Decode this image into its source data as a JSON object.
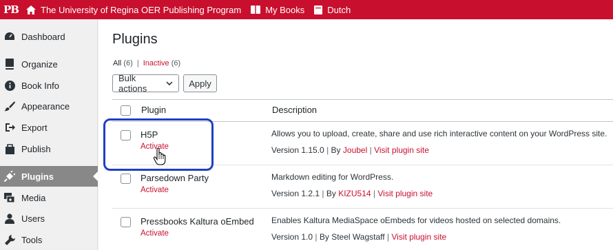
{
  "admin_bar": {
    "logo": "PB",
    "items": [
      {
        "label": "The University of Regina OER Publishing Program",
        "icon": "home-icon"
      },
      {
        "label": "My Books",
        "icon": "books-icon"
      },
      {
        "label": "Dutch",
        "icon": "book-icon"
      }
    ]
  },
  "sidebar": {
    "items": [
      {
        "label": "Dashboard",
        "icon": "dashboard-icon"
      },
      {
        "label": "Organize",
        "icon": "organize-icon"
      },
      {
        "label": "Book Info",
        "icon": "info-icon"
      },
      {
        "label": "Appearance",
        "icon": "brush-icon"
      },
      {
        "label": "Export",
        "icon": "export-icon"
      },
      {
        "label": "Publish",
        "icon": "publish-icon"
      },
      {
        "label": "Plugins",
        "icon": "plugin-icon"
      },
      {
        "label": "Media",
        "icon": "media-icon"
      },
      {
        "label": "Users",
        "icon": "users-icon"
      },
      {
        "label": "Tools",
        "icon": "tools-icon"
      }
    ],
    "active": "Plugins"
  },
  "main": {
    "title": "Plugins",
    "filters": {
      "all_label": "All",
      "all_count": "(6)",
      "separator": "|",
      "inactive_label": "Inactive",
      "inactive_count": "(6)"
    },
    "bulk_actions": {
      "selected": "Bulk actions"
    },
    "apply_label": "Apply",
    "table": {
      "columns": [
        "Plugin",
        "Description"
      ],
      "rows": [
        {
          "name": "H5P",
          "action": "Activate",
          "description": "Allows you to upload, create, share and use rich interactive content on your WordPress site.",
          "version": "Version 1.15.0",
          "by_prefix": "By",
          "author": "Joubel",
          "author_linked": true,
          "site_link": "Visit plugin site"
        },
        {
          "name": "Parsedown Party",
          "action": "Activate",
          "description": "Markdown editing for WordPress.",
          "version": "Version 1.2.1",
          "by_prefix": "By",
          "author": "KIZU514",
          "author_linked": true,
          "site_link": "Visit plugin site"
        },
        {
          "name": "Pressbooks Kaltura oEmbed",
          "action": "Activate",
          "description": "Enables Kaltura MediaSpace oEmbeds for videos hosted on selected domains.",
          "version": "Version 1.0",
          "by_prefix": "By",
          "author": "Steel Wagstaff",
          "author_linked": false,
          "site_link": "Visit plugin site"
        }
      ]
    }
  },
  "colors": {
    "brand": "#c8102e",
    "highlight": "#1f3fc4",
    "active_menu": "#888888"
  }
}
